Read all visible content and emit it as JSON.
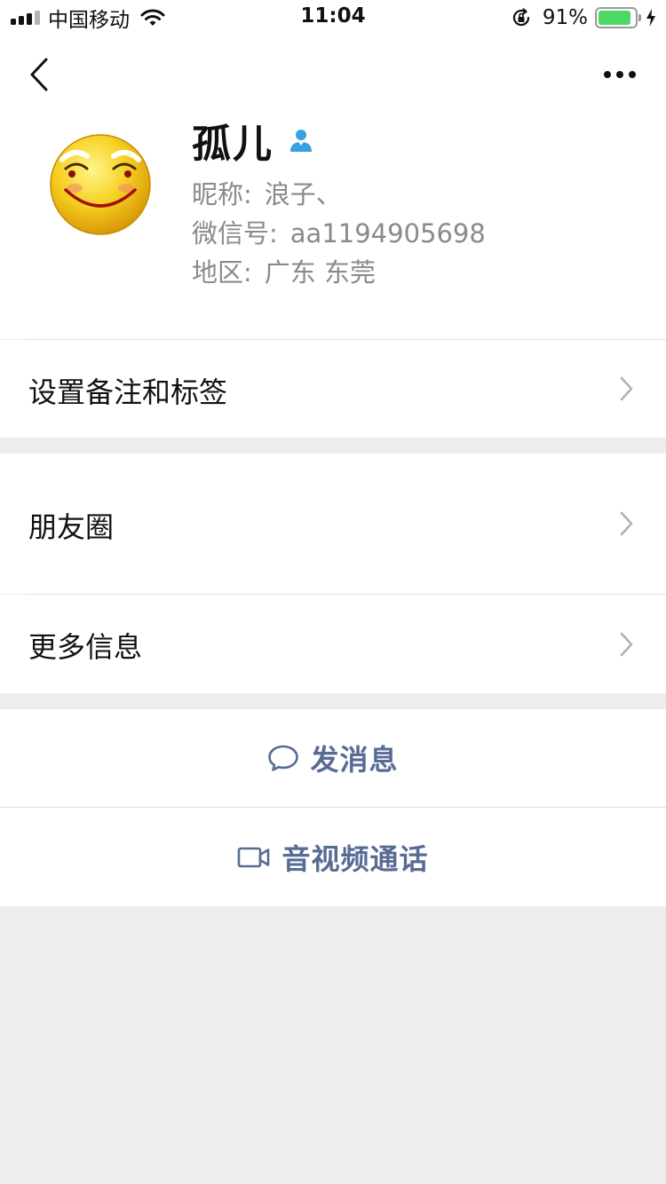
{
  "status_bar": {
    "carrier": "中国移动",
    "time": "11:04",
    "battery_percent": "91%",
    "battery_level": 0.91,
    "icons": [
      "signal-icon",
      "wifi-icon",
      "rotation-lock-icon",
      "battery-icon",
      "charging-icon"
    ]
  },
  "nav": {
    "back_icon": "chevron-left-icon",
    "more_icon": "ellipsis-icon"
  },
  "profile": {
    "name": "孤儿",
    "gender_icon": "male-user-icon",
    "nickname_label": "昵称:",
    "nickname": "浪子、",
    "wechat_id_label": "微信号:",
    "wechat_id": "aa1194905698",
    "region_label": "地区:",
    "region": "广东 东莞"
  },
  "menu": {
    "remark_tags": "设置备注和标签",
    "moments": "朋友圈",
    "more_info": "更多信息"
  },
  "actions": {
    "send_message": "发消息",
    "video_call": "音视频通话"
  },
  "colors": {
    "link_blue": "#576b95",
    "gender_blue": "#3aa0e0",
    "battery_green": "#4cd964",
    "background": "#ededed"
  }
}
